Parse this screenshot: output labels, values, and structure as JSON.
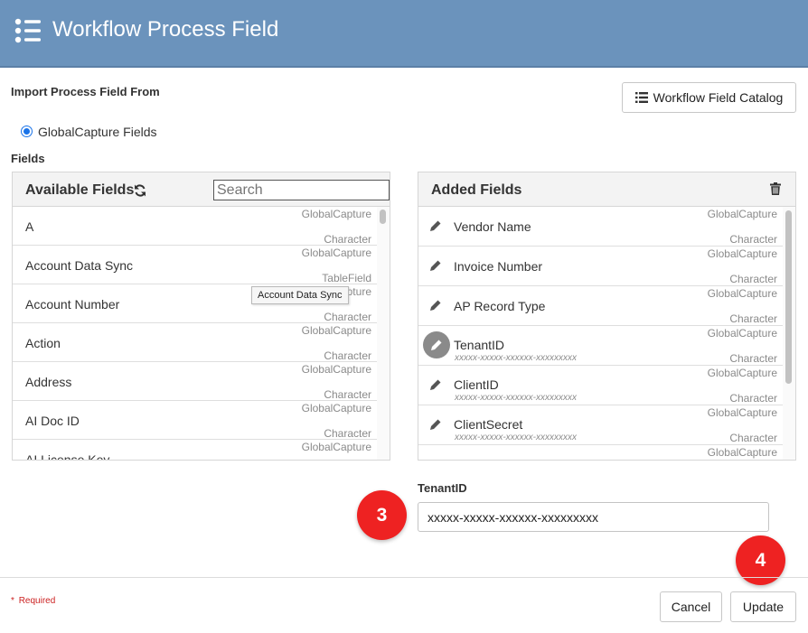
{
  "header": {
    "title": "Workflow Process Field",
    "menu_icon": "list-menu-icon"
  },
  "import": {
    "label": "Import Process Field From",
    "catalog_button": "Workflow Field Catalog",
    "radio_label": "GlobalCapture Fields"
  },
  "fields_label": "Fields",
  "available": {
    "title": "Available Fields",
    "search_placeholder": "Search",
    "rows": [
      {
        "name": "A",
        "source": "GlobalCapture",
        "type": "Character"
      },
      {
        "name": "Account Data Sync",
        "source": "GlobalCapture",
        "type": "TableField"
      },
      {
        "name": "Account Number",
        "source": "GlobalCapture",
        "type": "Character"
      },
      {
        "name": "Action",
        "source": "GlobalCapture",
        "type": "Character"
      },
      {
        "name": "Address",
        "source": "GlobalCapture",
        "type": "Character"
      },
      {
        "name": "AI Doc ID",
        "source": "GlobalCapture",
        "type": "Character"
      },
      {
        "name": "AI License Key",
        "source": "GlobalCapture",
        "type": ""
      }
    ],
    "tooltip": "Account Data Sync"
  },
  "added": {
    "title": "Added Fields",
    "rows": [
      {
        "name": "Vendor Name",
        "value": "",
        "source": "GlobalCapture",
        "type": "Character"
      },
      {
        "name": "Invoice Number",
        "value": "",
        "source": "GlobalCapture",
        "type": "Character"
      },
      {
        "name": "AP Record Type",
        "value": "",
        "source": "GlobalCapture",
        "type": "Character"
      },
      {
        "name": "TenantID",
        "value": "xxxxx-xxxxx-xxxxxx-xxxxxxxxx",
        "source": "GlobalCapture",
        "type": "Character"
      },
      {
        "name": "ClientID",
        "value": "xxxxx-xxxxx-xxxxxx-xxxxxxxxx",
        "source": "GlobalCapture",
        "type": "Character"
      },
      {
        "name": "ClientSecret",
        "value": "xxxxx-xxxxx-xxxxxx-xxxxxxxxx",
        "source": "GlobalCapture",
        "type": "Character"
      },
      {
        "name": "",
        "value": "",
        "source": "GlobalCapture",
        "type": ""
      }
    ]
  },
  "editor": {
    "label": "TenantID",
    "value": "xxxxx-xxxxx-xxxxxx-xxxxxxxxx"
  },
  "badges": {
    "step3": "3",
    "step4": "4"
  },
  "footer": {
    "required": "Required",
    "required_mark": "*",
    "cancel": "Cancel",
    "update": "Update"
  },
  "colors": {
    "header": "#6b93bc",
    "badge": "#ee2222",
    "accent": "#1a73e8"
  }
}
